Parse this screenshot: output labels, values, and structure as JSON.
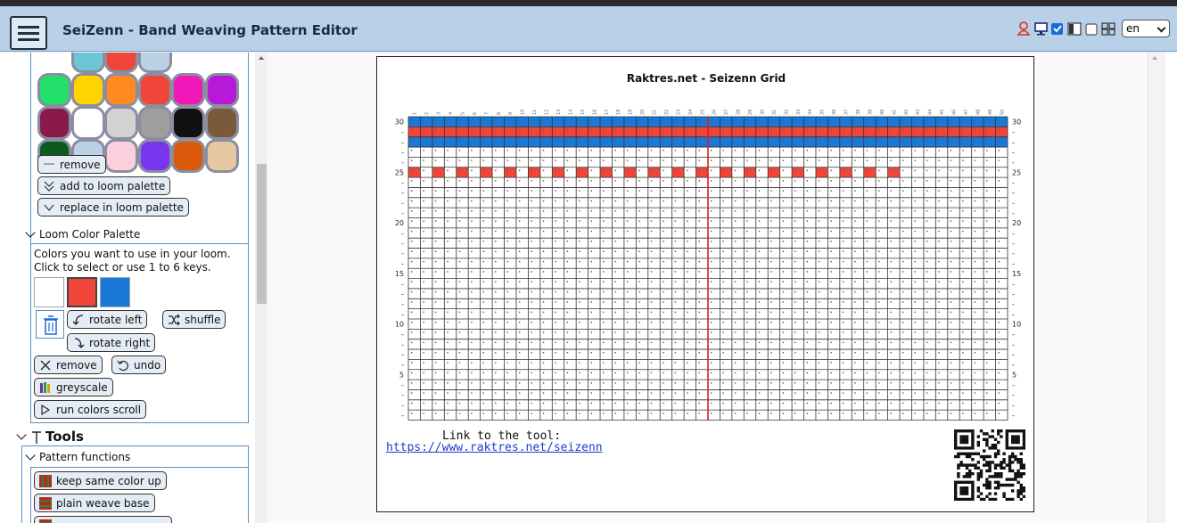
{
  "app": {
    "title": "SeiZenn - Band Weaving Pattern Editor",
    "language": "en"
  },
  "header_icons": [
    "user-icon",
    "monitor-icon",
    "checkbox-checked-icon",
    "panel-layout-icon",
    "checkbox-unchecked-icon",
    "grid-layout-icon"
  ],
  "sidebar": {
    "palette_colors": [
      "#22e06a",
      "#ffd400",
      "#ff8a1e",
      "#f0463a",
      "#f018b8",
      "#b818d8",
      "#8a1a4a",
      "#ffffff",
      "#d2d2d2",
      "#9e9e9e",
      "#101010",
      "#7a5a3a",
      "#0c5a1c",
      "#bcd0e6",
      "#fad0dc",
      "#7a36ee",
      "#d85a0a",
      "#e6c8a0"
    ],
    "remove_label": "remove",
    "add_to_loom_label": "add to loom palette",
    "replace_in_loom_label": "replace in loom palette",
    "loom_palette_title": "Loom Color Palette",
    "loom_palette_text_1": "Colors you want to use in your loom.",
    "loom_palette_text_2": "Click to select or use 1 to 6 keys.",
    "loom_colors": [
      "#ffffff",
      "#f0463a",
      "#1a78d8"
    ],
    "rotate_left_label": "rotate left",
    "shuffle_label": "shuffle",
    "rotate_right_label": "rotate right",
    "remove2_label": "remove",
    "undo_label": "undo",
    "greyscale_label": "greyscale",
    "run_colors_label": "run colors scroll",
    "tools_title": "Tools",
    "pattern_functions_title": "Pattern functions",
    "keep_same_label": "keep same color up",
    "plain_weave_label": "plain weave base"
  },
  "document": {
    "title": "Raktres.net - Seizenn Grid",
    "link_label": "Link to the tool:",
    "link_url": "https://www.raktres.net/seizenn"
  },
  "grid": {
    "columns": 50,
    "rows": 30,
    "row_labels": [
      "30",
      "25",
      "20",
      "15",
      "10",
      "5"
    ],
    "highlight_column": 25,
    "colored_rows": [
      {
        "row": 30,
        "color": "#1a78d8",
        "pattern": "all"
      },
      {
        "row": 29,
        "color": "#f0463a",
        "pattern": "all"
      },
      {
        "row": 28,
        "color": "#1a78d8",
        "pattern": "all"
      },
      {
        "row": 25,
        "color": "#f0463a",
        "pattern": "alternate"
      }
    ],
    "red_alt_last_column": 41
  }
}
